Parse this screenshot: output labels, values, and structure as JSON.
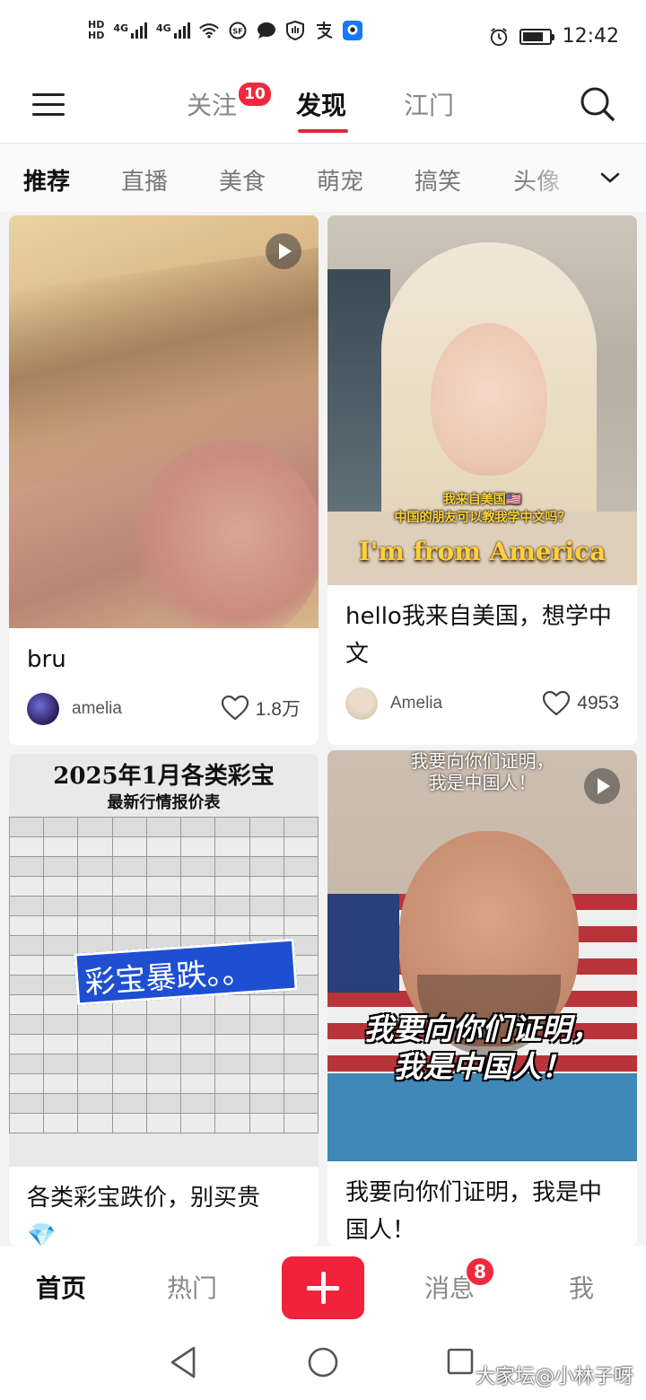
{
  "status": {
    "hd1": "HD",
    "hd2": "HD",
    "net1": "4G",
    "net2": "4G",
    "time": "12:42",
    "battery_level": 0.8,
    "icons": [
      "wifi-icon",
      "sf-icon",
      "chat-bubble-icon",
      "hand-icon",
      "alipay-icon",
      "app-icon",
      "alarm-icon",
      "battery-icon"
    ]
  },
  "topnav": {
    "tabs": [
      {
        "label": "关注",
        "badge": "10"
      },
      {
        "label": "发现",
        "active": true
      },
      {
        "label": "江门"
      }
    ],
    "accent": "#e8253a"
  },
  "categories": [
    "推荐",
    "直播",
    "美食",
    "萌宠",
    "搞笑",
    "头像"
  ],
  "cards": [
    {
      "title": "bru",
      "author": "amelia",
      "likes": "1.8万",
      "video": true
    },
    {
      "title": "hello我来自美国，想学中文",
      "author": "Amelia",
      "likes": "4953",
      "subtitle_top": "我来自美国🇺🇸",
      "subtitle_mid": "中国的朋友可以教我学中文吗？",
      "subtitle_big": "I'm from America"
    },
    {
      "title": "各类彩宝跌价，别买贵",
      "title_emoji": "💎",
      "image_title": "2025年1月各类彩宝",
      "image_subtitle": "最新行情报价表",
      "sticker": "彩宝暴跌。。"
    },
    {
      "title": "我要向你们证明，我是中国人！",
      "video": true,
      "image_top": "我要向你们证明，\n我是中国人！",
      "image_big": "我要向你们证明，\n我是中国人！"
    }
  ],
  "bottomnav": {
    "items": [
      "首页",
      "热门",
      "消息",
      "我"
    ],
    "messages_badge": "8"
  },
  "watermark": "大家坛@小林子呀"
}
